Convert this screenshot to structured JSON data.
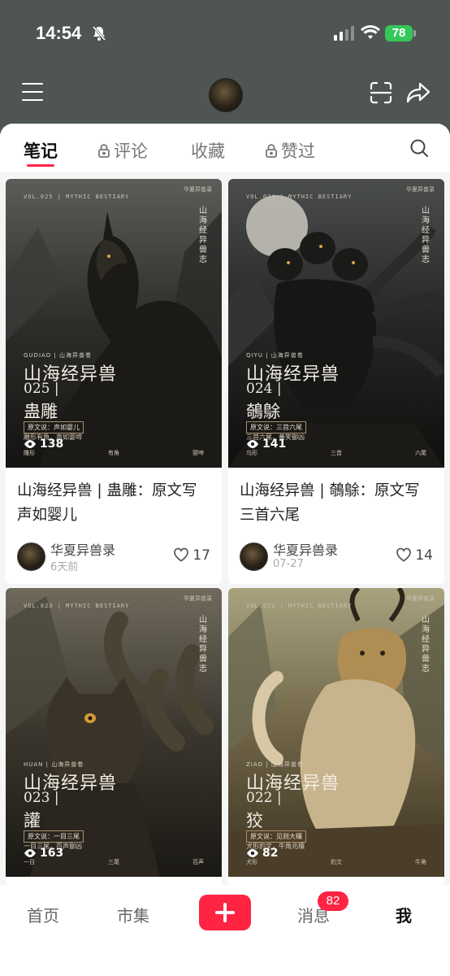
{
  "status_bar": {
    "time": "14:54",
    "battery": "78"
  },
  "tabs": [
    {
      "label": "笔记",
      "locked": false
    },
    {
      "label": "评论",
      "locked": true
    },
    {
      "label": "收藏",
      "locked": false
    },
    {
      "label": "赞过",
      "locked": true
    }
  ],
  "posts": [
    {
      "cover": {
        "vol": "VOL.025 | MYTHIC BESTIARY",
        "corner": "华夏异兽录",
        "vertical": "山海经异兽志",
        "pinyin": "GUDIAO | 山海异兽卷",
        "series": "山海经异兽",
        "number": "025 |",
        "name": "蛊雕",
        "tag": "原文说：声如婴儿",
        "note": "雕形有角，声如婴啼",
        "footer": [
          "雕形",
          "有角",
          "婴啼"
        ],
        "views": "138"
      },
      "title": "山海经异兽 | 蛊雕：原文写声如婴儿",
      "author": "华夏异兽录",
      "time": "6天前",
      "likes": "17"
    },
    {
      "cover": {
        "vol": "VOL.024 | MYTHIC BESTIARY",
        "corner": "华夏异兽录",
        "vertical": "山海经异兽志",
        "pinyin": "QIYU | 山海异兽卷",
        "series": "山海经异兽",
        "number": "024 |",
        "name": "鵸鵌",
        "tag": "原文说：三首六尾",
        "note": "三首六尾，善笑御凶",
        "footer": [
          "乌形",
          "三首",
          "六尾"
        ],
        "views": "141"
      },
      "title": "山海经异兽 | 鵸鵌：原文写三首六尾",
      "author": "华夏异兽录",
      "time": "07-27",
      "likes": "14"
    },
    {
      "cover": {
        "vol": "VOL.023 | MYTHIC BESTIARY",
        "corner": "华夏异兽录",
        "vertical": "山海经异兽志",
        "pinyin": "HUAN | 山海异兽卷",
        "series": "山海经异兽",
        "number": "023 |",
        "name": "讙",
        "tag": "原文说：一目三尾",
        "note": "一目三尾，百声御凶",
        "footer": [
          "一目",
          "三尾",
          "百声"
        ],
        "views": "163"
      },
      "title": "",
      "author": "",
      "time": "",
      "likes": ""
    },
    {
      "cover": {
        "vol": "VOL.022 | MYTHIC BESTIARY",
        "corner": "华夏异兽录",
        "vertical": "山海经异兽志",
        "pinyin": "ZIAO | 山海异兽卷",
        "series": "山海经异兽",
        "number": "022 |",
        "name": "狡",
        "tag": "原文说：见则大穰",
        "note": "犬形豹文，牛角兆穰",
        "footer": [
          "犬形",
          "豹文",
          "牛角"
        ],
        "views": "82"
      },
      "title": "",
      "author": "",
      "time": "",
      "likes": ""
    }
  ],
  "bottom_nav": [
    {
      "label": "首页"
    },
    {
      "label": "市集"
    },
    {
      "label": "消息",
      "badge": "82"
    },
    {
      "label": "我"
    }
  ],
  "colors": {
    "accent": "#ff2442",
    "header_bg": "#4e5552"
  }
}
